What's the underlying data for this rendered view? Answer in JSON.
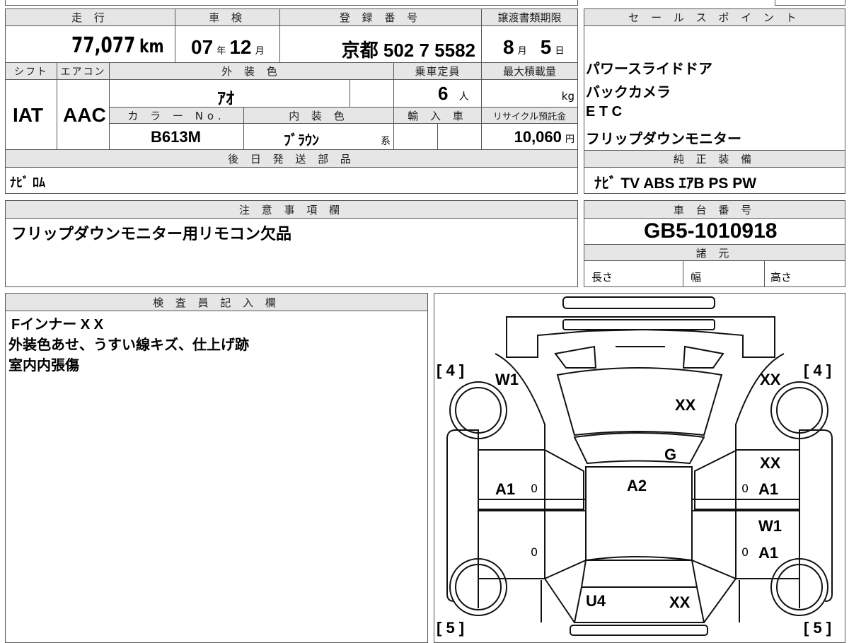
{
  "top": {
    "mileage_label": "走 行",
    "mileage_value": "77,077",
    "mileage_unit": "km",
    "inspection_label": "車 検",
    "inspection_year": "07",
    "inspection_year_unit": "年",
    "inspection_month": "12",
    "inspection_month_unit": "月",
    "plate_label": "登 録 番 号",
    "plate_value": "京都 502 7 5582",
    "deadline_label": "譲渡書類期限",
    "deadline_month": "8",
    "deadline_month_unit": "月",
    "deadline_day": "5",
    "deadline_day_unit": "日"
  },
  "row2": {
    "shift_label": "シフト",
    "shift_value": "IAT",
    "aircon_label": "エアコン",
    "aircon_value": "AAC",
    "exterior_label": "外 装 色",
    "exterior_value": "ｱｵ",
    "capacity_label": "乗車定員",
    "capacity_value": "6",
    "capacity_unit": "人",
    "maxload_label": "最大積載量",
    "maxload_unit": "kg",
    "colorno_label": "カ ラ ー No.",
    "colorno_value": "B613M",
    "interior_label": "内 装 色",
    "interior_value": "ﾌﾞﾗｳﾝ",
    "interior_unit": "系",
    "import_label": "輸 入 車",
    "recycle_label": "リサイクル預託金",
    "recycle_value": "10,060",
    "recycle_unit": "円"
  },
  "later_parts": {
    "label": "後 日 発 送 部 品",
    "value": "ﾅﾋﾞ ﾛﾑ"
  },
  "sales": {
    "label": "セ ー ル ス ポ イ ン ト",
    "points": [
      "パワースライドドア",
      "バックカメラ",
      "E T C",
      "フリップダウンモニター"
    ]
  },
  "equipment": {
    "label": "純 正 装 備",
    "value": "ﾅﾋﾞ  TV  ABS  ｴｱB  PS  PW"
  },
  "notes": {
    "label": "注 意 事 項 欄",
    "value": "フリップダウンモニター用リモコン欠品"
  },
  "chassis": {
    "label": "車 台 番 号",
    "value": "GB5-1010918",
    "specs_label": "諸 元",
    "length_label": "長さ",
    "width_label": "幅",
    "height_label": "高さ"
  },
  "inspector": {
    "label": "検 査 員 記 入 欄",
    "lines": [
      "Fインナー X X",
      "外装色あせ、うすい線キズ、仕上げ跡",
      "室内内張傷"
    ]
  },
  "diagram": {
    "tire_fl": "[ 4 ]",
    "tire_fr": "[ 4 ]",
    "tire_rl": "[ 5 ]",
    "tire_rr": "[ 5 ]",
    "marks": {
      "front_left": "W1",
      "front_right": "XX",
      "hood": "XX",
      "windshield": "G",
      "right_front_fender": "XX",
      "left_front_door": "A1",
      "roof": "A2",
      "right_front_door": "A1",
      "right_rear_upper": "W1",
      "right_rear_door": "A1",
      "rear_left": "U4",
      "rear_right": "XX",
      "door_zero": "0"
    }
  }
}
